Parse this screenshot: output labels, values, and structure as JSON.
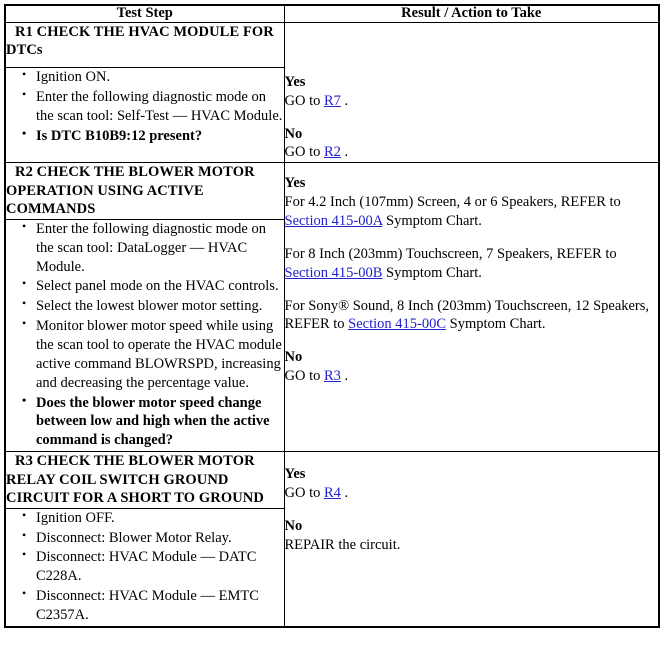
{
  "table": {
    "headers": {
      "test_step": "Test Step",
      "result_action": "Result / Action to Take"
    },
    "link_color": "#2222cc",
    "steps": [
      {
        "id": "R1",
        "title": "R1 CHECK THE HVAC MODULE FOR DTCs",
        "bullets": [
          {
            "text": "Ignition ON.",
            "bold": false
          },
          {
            "text": "Enter the following diagnostic mode on the scan tool: Self-Test — HVAC Module.",
            "bold": false
          },
          {
            "text": "Is DTC B10B9:12 present?",
            "bold": true
          }
        ],
        "results": [
          {
            "label": "Yes",
            "lines": [
              {
                "pre": "GO to ",
                "link": "R7",
                "post": " ."
              }
            ]
          },
          {
            "label": "No",
            "lines": [
              {
                "pre": "GO to ",
                "link": "R2",
                "post": " ."
              }
            ]
          }
        ]
      },
      {
        "id": "R2",
        "title": "R2 CHECK THE BLOWER MOTOR OPERATION USING ACTIVE COMMANDS",
        "bullets": [
          {
            "text": "Enter the following diagnostic mode on the scan tool: DataLogger — HVAC Module.",
            "bold": false
          },
          {
            "text": "Select panel mode on the HVAC controls.",
            "bold": false
          },
          {
            "text": "Select the lowest blower motor setting.",
            "bold": false
          },
          {
            "text": "Monitor blower motor speed while using the scan tool to operate the HVAC module active command BLOWRSPD, increasing and decreasing the percentage value.",
            "bold": false
          },
          {
            "text": "Does the blower motor speed change between low and high when the active command is changed?",
            "bold": true
          }
        ],
        "results": [
          {
            "label": "Yes",
            "lines": [
              {
                "pre": "For 4.2 Inch (107mm) Screen, 4 or 6 Speakers, REFER to ",
                "link": "Section 415-00A",
                "post": " Symptom Chart."
              },
              {
                "gap": true
              },
              {
                "pre": "For 8 Inch (203mm) Touchscreen, 7 Speakers, REFER to ",
                "link": "Section 415-00B",
                "post": " Symptom Chart."
              },
              {
                "gap": true
              },
              {
                "pre": "For Sony® Sound, 8 Inch (203mm) Touchscreen, 12 Speakers, REFER to ",
                "link": "Section 415-00C",
                "post": " Symptom Chart."
              }
            ]
          },
          {
            "label": "No",
            "lines": [
              {
                "pre": "GO to ",
                "link": "R3",
                "post": " ."
              }
            ]
          }
        ]
      },
      {
        "id": "R3",
        "title": "R3 CHECK THE BLOWER MOTOR RELAY COIL SWITCH GROUND CIRCUIT FOR A SHORT TO GROUND",
        "bullets": [
          {
            "text": "Ignition OFF.",
            "bold": false
          },
          {
            "text": "Disconnect: Blower Motor Relay.",
            "bold": false
          },
          {
            "text": "Disconnect: HVAC Module — DATC C228A.",
            "bold": false
          },
          {
            "text": "Disconnect: HVAC Module — EMTC C2357A.",
            "bold": false
          }
        ],
        "results": [
          {
            "label": "Yes",
            "lines": [
              {
                "pre": "GO to ",
                "link": "R4",
                "post": " ."
              }
            ]
          },
          {
            "label": "No",
            "lines": [
              {
                "pre": "REPAIR the circuit.",
                "link": null,
                "post": ""
              }
            ]
          }
        ]
      }
    ]
  }
}
